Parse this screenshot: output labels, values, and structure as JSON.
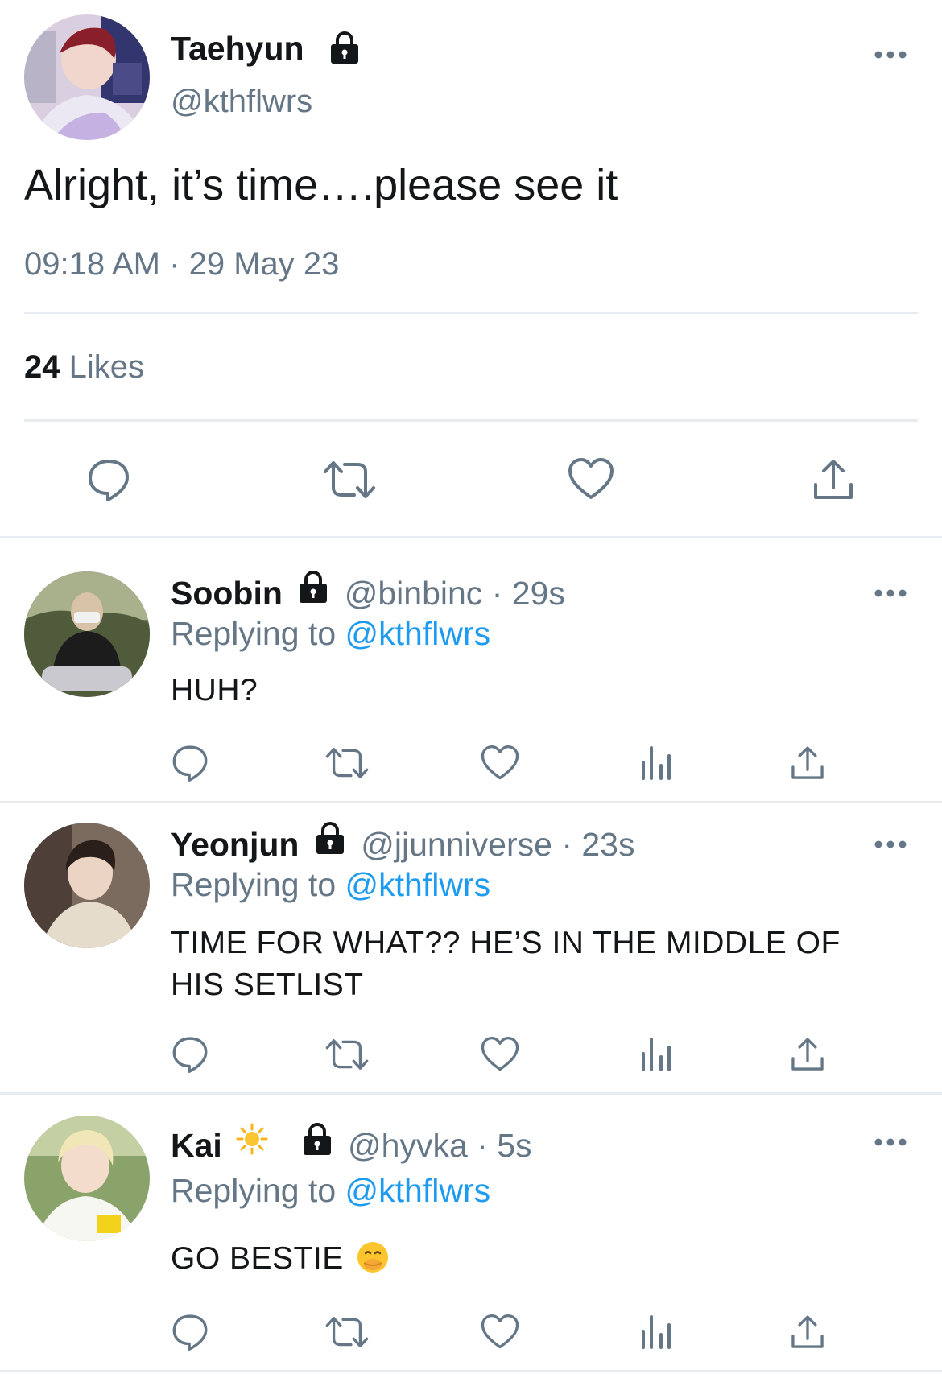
{
  "main_tweet": {
    "display_name": "Taehyun",
    "handle": "@kthflwrs",
    "text": "Alright, it’s time….please see it",
    "time": "09:18 AM",
    "date": "29 May 23",
    "dot": "·",
    "likes_count": "24",
    "likes_label": "Likes"
  },
  "replies": [
    {
      "display_name": "Soobin",
      "handle": "@binbinc",
      "age": "29s",
      "dot": "·",
      "replying_prefix": "Replying to",
      "replying_handle": "@kthflwrs",
      "text": "HUH?",
      "emoji": ""
    },
    {
      "display_name": "Yeonjun",
      "handle": "@jjunniverse",
      "age": "23s",
      "dot": "·",
      "replying_prefix": "Replying to",
      "replying_handle": "@kthflwrs",
      "text": "TIME FOR WHAT?? HE’S IN THE MIDDLE OF HIS SETLIST",
      "emoji": ""
    },
    {
      "display_name": "Kai",
      "name_emoji": "☀️",
      "handle": "@hyvka",
      "age": "5s",
      "dot": "·",
      "replying_prefix": "Replying to",
      "replying_handle": "@kthflwrs",
      "text": "GO BESTIE",
      "emoji": "🤭"
    }
  ],
  "colors": {
    "text": "#14171a",
    "secondary": "#657786",
    "link": "#1d9bf0",
    "divider": "#e6ecf0"
  },
  "icons": {
    "lock": "lock-icon",
    "more": "more-icon",
    "reply": "reply-icon",
    "retweet": "retweet-icon",
    "like": "heart-icon",
    "analytics": "analytics-icon",
    "share": "share-icon"
  }
}
